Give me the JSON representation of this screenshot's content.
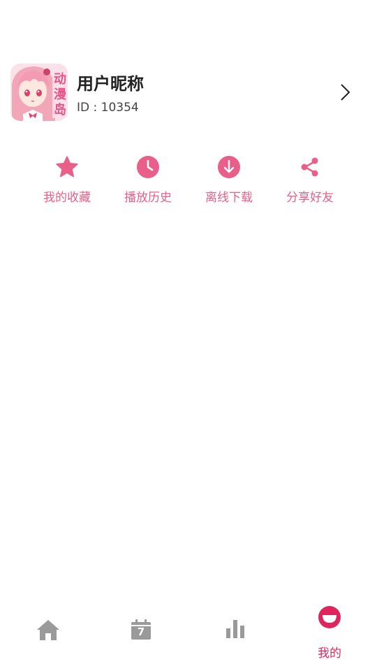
{
  "profile": {
    "nickname": "用户昵称",
    "id_text": "ID : 10354",
    "logo_text": "动漫岛"
  },
  "actions": [
    {
      "label": "我的收藏",
      "icon": "star-icon"
    },
    {
      "label": "播放历史",
      "icon": "clock-icon"
    },
    {
      "label": "离线下载",
      "icon": "download-icon"
    },
    {
      "label": "分享好友",
      "icon": "share-icon"
    }
  ],
  "tabbar": {
    "calendar_day": "7",
    "active_label": "我的",
    "items": [
      "home-icon",
      "calendar-icon",
      "bar-chart-icon",
      "profile-face-icon"
    ]
  },
  "colors": {
    "accent": "#ea5f8a",
    "active_tab": "#e0255e",
    "inactive_tab": "#9a9a9a"
  }
}
